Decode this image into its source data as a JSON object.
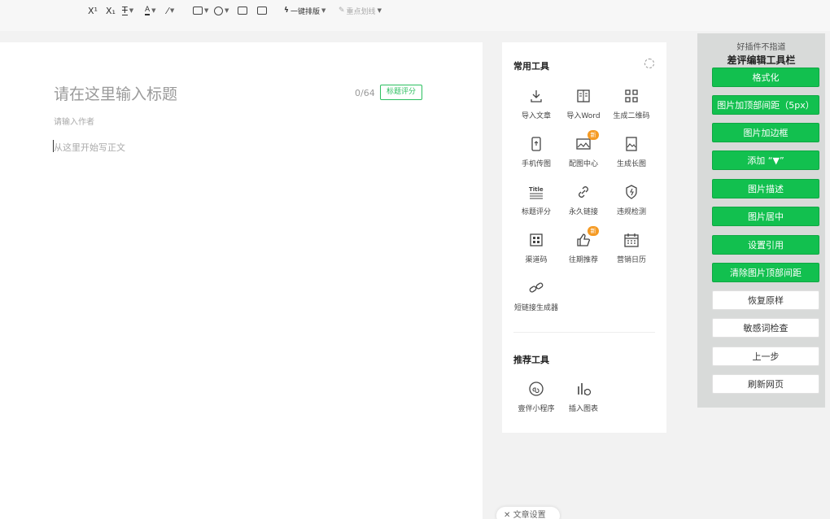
{
  "toolbar": {
    "superscript": "X¹",
    "subscript": "X₁",
    "one_click_format": "一键排版",
    "highlight_marking": "重点划线"
  },
  "editor": {
    "title_placeholder": "请在这里输入标题",
    "title_count": "0/64",
    "title_score_button": "标题评分",
    "author_placeholder": "请输入作者",
    "body_placeholder": "从这里开始写正文"
  },
  "tools_panel": {
    "common_title": "常用工具",
    "common_tools": [
      {
        "label": "导入文章",
        "icon": "import-article-icon"
      },
      {
        "label": "导入Word",
        "icon": "import-word-icon"
      },
      {
        "label": "生成二维码",
        "icon": "qrcode-icon"
      },
      {
        "label": "手机传图",
        "icon": "phone-upload-icon"
      },
      {
        "label": "配图中心",
        "icon": "image-center-icon",
        "badge": "新"
      },
      {
        "label": "生成长图",
        "icon": "long-image-icon"
      },
      {
        "label": "标题评分",
        "icon": "title-score-icon"
      },
      {
        "label": "永久链接",
        "icon": "permanent-link-icon"
      },
      {
        "label": "违规检测",
        "icon": "violation-check-icon"
      },
      {
        "label": "渠道码",
        "icon": "channel-code-icon"
      },
      {
        "label": "往期推荐",
        "icon": "past-recommend-icon",
        "badge": "新"
      },
      {
        "label": "营销日历",
        "icon": "calendar-icon"
      },
      {
        "label": "短链接生成器",
        "icon": "short-link-icon"
      }
    ],
    "recommended_title": "推荐工具",
    "recommended_tools": [
      {
        "label": "壹伴小程序",
        "icon": "mini-program-icon"
      },
      {
        "label": "插入图表",
        "icon": "insert-chart-icon"
      }
    ]
  },
  "helper_panel": {
    "subtitle": "好插件不指道",
    "title": "差评编辑工具栏",
    "buttons": [
      {
        "label": "格式化",
        "style": "green"
      },
      {
        "label": "图片加顶部间距（5px）",
        "style": "green"
      },
      {
        "label": "图片加边框",
        "style": "green"
      },
      {
        "label": "添加 “▼”",
        "style": "green"
      },
      {
        "label": "图片描述",
        "style": "green"
      },
      {
        "label": "图片居中",
        "style": "green"
      },
      {
        "label": "设置引用",
        "style": "green"
      },
      {
        "label": "清除图片顶部间距",
        "style": "green"
      },
      {
        "label": "恢复原样",
        "style": "white"
      },
      {
        "label": "敏感词检查",
        "style": "white"
      },
      {
        "label": "上一步",
        "style": "white"
      },
      {
        "label": "刷新网页",
        "style": "white"
      }
    ]
  },
  "footer": {
    "article_settings": "文章设置"
  },
  "colors": {
    "accent_green": "#12c04f",
    "badge_orange": "#f59a23"
  }
}
